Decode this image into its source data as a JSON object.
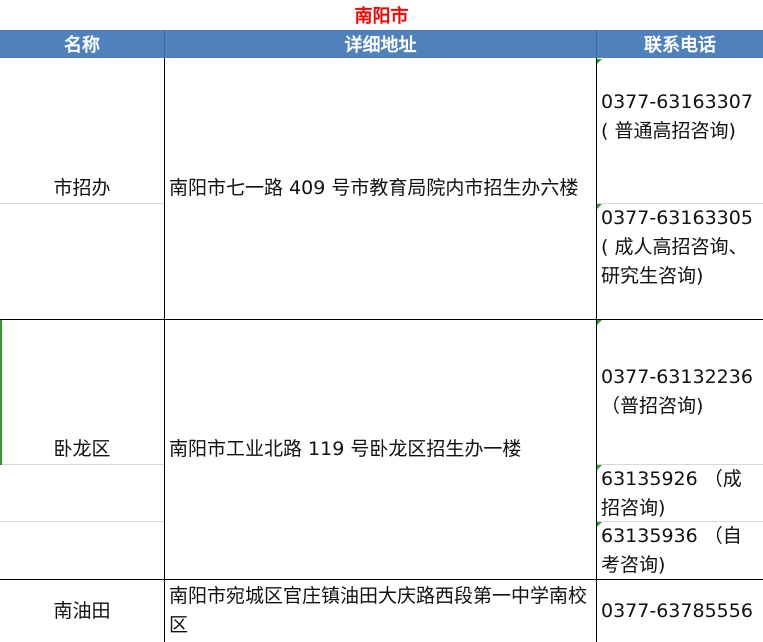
{
  "sheet": {
    "title": "南阳市",
    "headers": {
      "name": "名称",
      "address": "详细地址",
      "phone": "联系电话"
    },
    "rows": [
      {
        "name": "市招办",
        "address": "南阳市七一路 409 号市教育局院内市招生办六楼",
        "phones": [
          "0377-63163307( 普通高招咨询)",
          "0377-63163305( 成人高招咨询、研究生咨询)"
        ]
      },
      {
        "name": "卧龙区",
        "address": "南阳市工业北路 119 号卧龙区招生办一楼",
        "phones": [
          "0377-63132236 （普招咨询)",
          "63135926 （成招咨询)",
          "63135936 （自考咨询)"
        ]
      },
      {
        "name": "南油田",
        "address": "南阳市宛城区官庄镇油田大庆路西段第一中学南校区",
        "phones": [
          "0377-63785556"
        ]
      }
    ],
    "colors": {
      "title": "#ff0000",
      "header_bg": "#4f81bd",
      "header_text": "#ffffff",
      "marker": "#2aa02a"
    }
  }
}
